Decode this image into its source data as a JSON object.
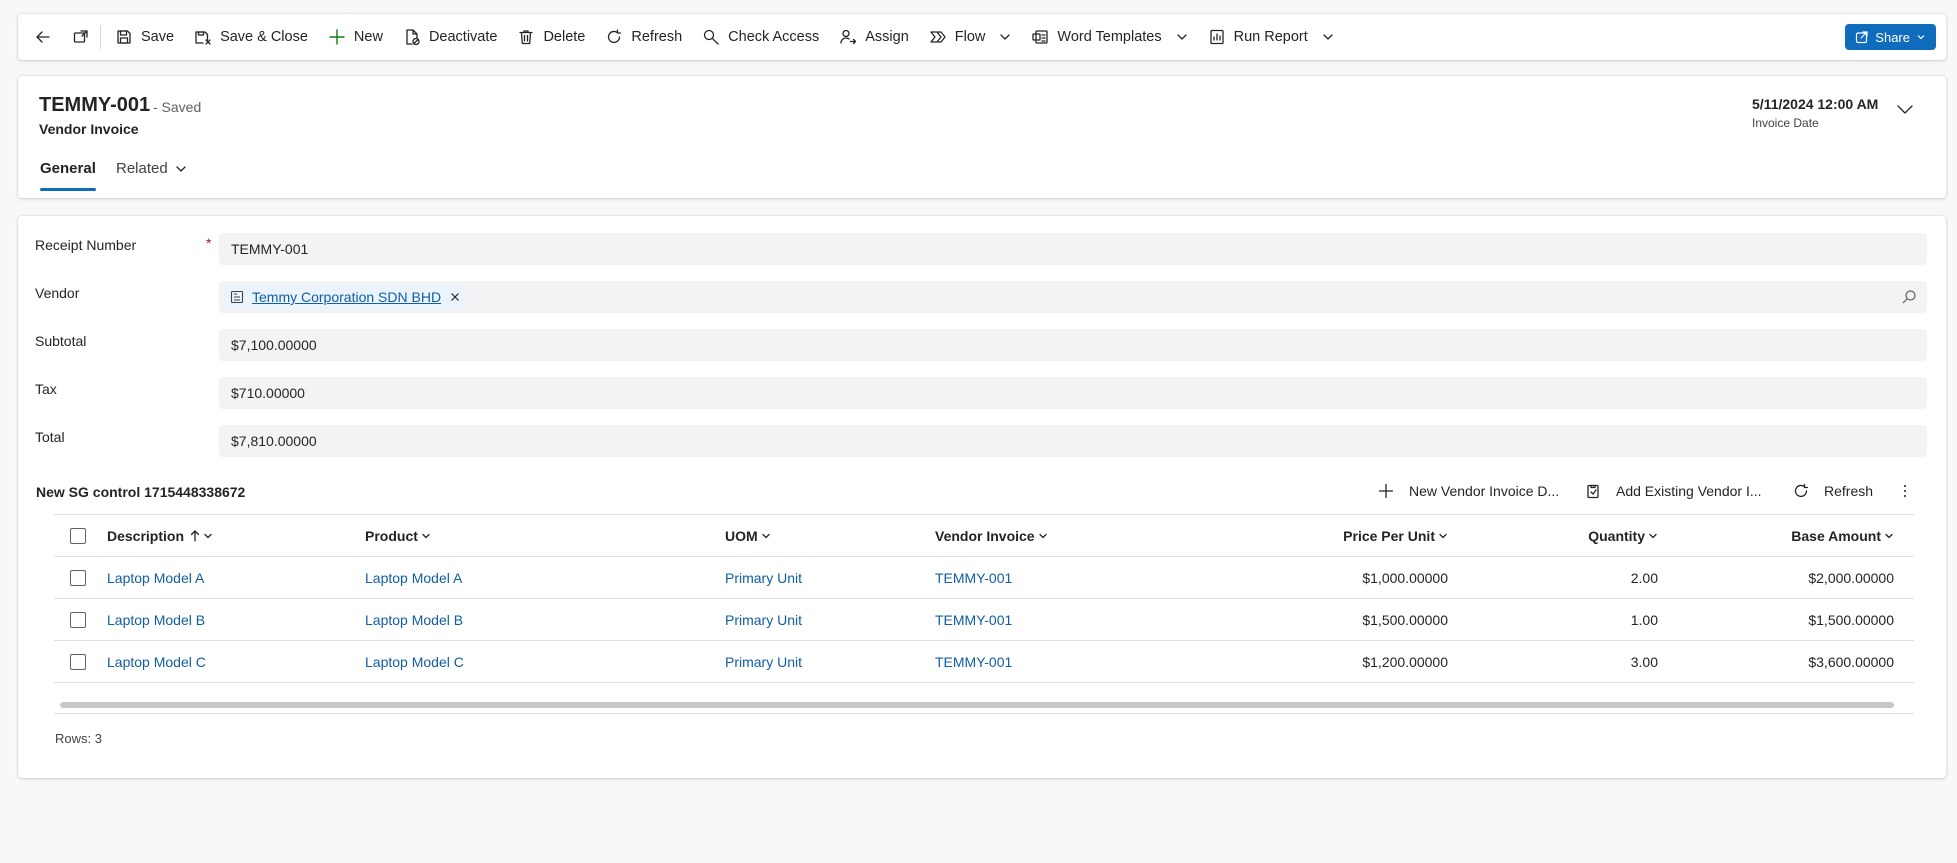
{
  "toolbar": {
    "back_label": "",
    "popout_label": "",
    "save": "Save",
    "save_close": "Save & Close",
    "new": "New",
    "deactivate": "Deactivate",
    "delete": "Delete",
    "refresh": "Refresh",
    "check_access": "Check Access",
    "assign": "Assign",
    "flow": "Flow",
    "word_templates": "Word Templates",
    "run_report": "Run Report",
    "share": "Share"
  },
  "header": {
    "record_name": "TEMMY-001",
    "status": "- Saved",
    "entity": "Vendor Invoice",
    "invoice_date_value": "5/11/2024 12:00 AM",
    "invoice_date_label": "Invoice Date",
    "tabs": [
      {
        "label": "General",
        "active": true
      },
      {
        "label": "Related",
        "active": false
      }
    ]
  },
  "form": {
    "receipt_number": {
      "label": "Receipt Number",
      "value": "TEMMY-001",
      "required": true
    },
    "vendor": {
      "label": "Vendor",
      "value": "Temmy Corporation SDN BHD"
    },
    "subtotal": {
      "label": "Subtotal",
      "value": "$7,100.00000"
    },
    "tax": {
      "label": "Tax",
      "value": "$710.00000"
    },
    "total": {
      "label": "Total",
      "value": "$7,810.00000"
    }
  },
  "subgrid": {
    "title": "New SG control 1715448338672",
    "commands": {
      "new": "New Vendor Invoice D...",
      "add_existing": "Add Existing Vendor I...",
      "refresh": "Refresh"
    },
    "columns": {
      "description": "Description",
      "product": "Product",
      "uom": "UOM",
      "vendor_invoice": "Vendor Invoice",
      "price": "Price Per Unit",
      "quantity": "Quantity",
      "base_amount": "Base Amount"
    },
    "rows": [
      {
        "description": "Laptop Model A",
        "product": "Laptop Model A",
        "uom": "Primary Unit",
        "vendor_invoice": "TEMMY-001",
        "price": "$1,000.00000",
        "quantity": "2.00",
        "base_amount": "$2,000.00000"
      },
      {
        "description": "Laptop Model B",
        "product": "Laptop Model B",
        "uom": "Primary Unit",
        "vendor_invoice": "TEMMY-001",
        "price": "$1,500.00000",
        "quantity": "1.00",
        "base_amount": "$1,500.00000"
      },
      {
        "description": "Laptop Model C",
        "product": "Laptop Model C",
        "uom": "Primary Unit",
        "vendor_invoice": "TEMMY-001",
        "price": "$1,200.00000",
        "quantity": "3.00",
        "base_amount": "$3,600.00000"
      }
    ],
    "rows_count": "Rows: 3"
  },
  "colors": {
    "accent": "#0f6cbd",
    "link": "#115ea3",
    "required": "#c50f1f",
    "field_bg": "#f3f3f3"
  }
}
